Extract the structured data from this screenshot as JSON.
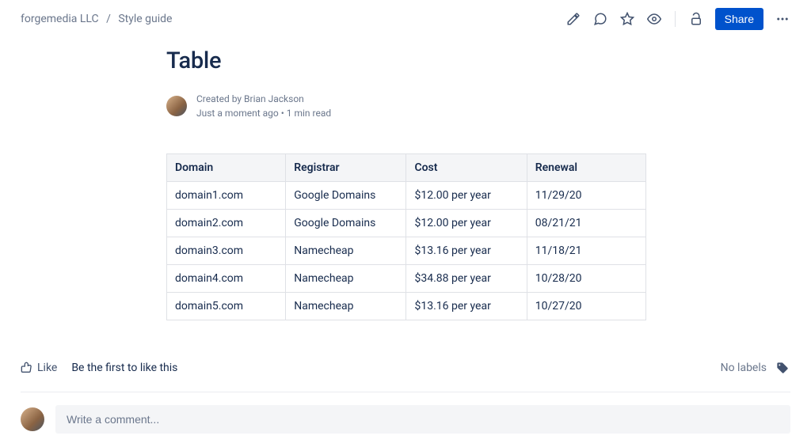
{
  "breadcrumb": {
    "space": "forgemedia LLC",
    "page": "Style guide"
  },
  "toolbar": {
    "share_label": "Share"
  },
  "page": {
    "title": "Table",
    "created_by_prefix": "Created by ",
    "author": "Brian Jackson",
    "timestamp": "Just a moment ago",
    "read_time": "1 min read"
  },
  "table": {
    "headers": [
      "Domain",
      "Registrar",
      "Cost",
      "Renewal"
    ],
    "rows": [
      [
        "domain1.com",
        "Google Domains",
        "$12.00 per year",
        "11/29/20"
      ],
      [
        "domain2.com",
        "Google Domains",
        "$12.00 per year",
        "08/21/21"
      ],
      [
        "domain3.com",
        "Namecheap",
        "$13.16 per year",
        "11/18/21"
      ],
      [
        "domain4.com",
        "Namecheap",
        "$34.88 per year",
        "10/28/20"
      ],
      [
        "domain5.com",
        "Namecheap",
        "$13.16 per year",
        "10/27/20"
      ]
    ]
  },
  "footer": {
    "like_label": "Like",
    "like_hint": "Be the first to like this",
    "no_labels": "No labels"
  },
  "comment": {
    "placeholder": "Write a comment..."
  }
}
